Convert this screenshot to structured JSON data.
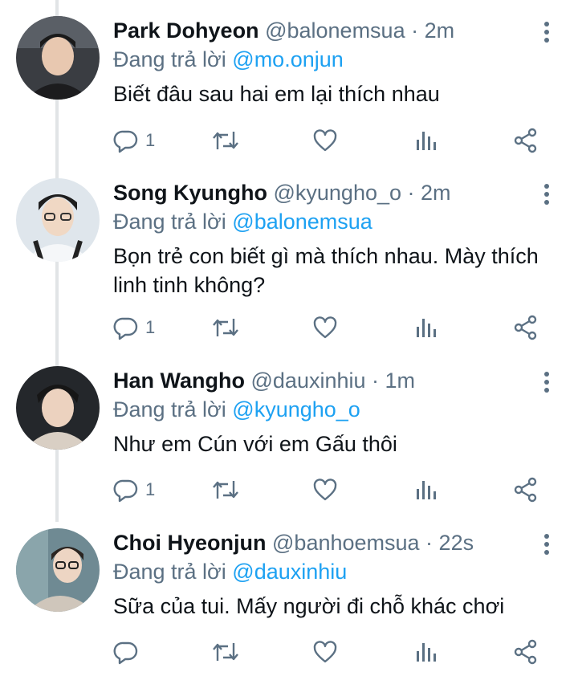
{
  "tweets": [
    {
      "name": "Park Dohyeon",
      "handle": "@balonemsua",
      "time": "2m",
      "reply_prefix": "Đang trả lời",
      "reply_to": "@mo.onjun",
      "text": "Biết đâu sau hai em lại thích nhau",
      "reply_count": "1"
    },
    {
      "name": "Song Kyungho",
      "handle": "@kyungho_o",
      "time": "2m",
      "reply_prefix": "Đang trả lời",
      "reply_to": "@balonemsua",
      "text": "Bọn trẻ con biết gì mà thích nhau. Mày thích linh tinh không?",
      "reply_count": "1"
    },
    {
      "name": "Han Wangho",
      "handle": "@dauxinhiu",
      "time": "1m",
      "reply_prefix": "Đang trả lời",
      "reply_to": "@kyungho_o",
      "text": "Như em Cún với em Gấu thôi",
      "reply_count": "1"
    },
    {
      "name": "Choi Hyeonjun",
      "handle": "@banhoemsua",
      "time": "22s",
      "reply_prefix": "Đang trả lời",
      "reply_to": "@dauxinhiu",
      "text": "Sữa của tui. Mấy người đi chỗ khác chơi",
      "reply_count": ""
    }
  ],
  "separator": " · ",
  "colors": {
    "accent": "#1da1f2",
    "secondary": "#5b7083",
    "icon": "#5b7083"
  },
  "icons": [
    "reply-icon",
    "retweet-icon",
    "like-icon",
    "analytics-icon",
    "share-icon",
    "more-icon"
  ]
}
